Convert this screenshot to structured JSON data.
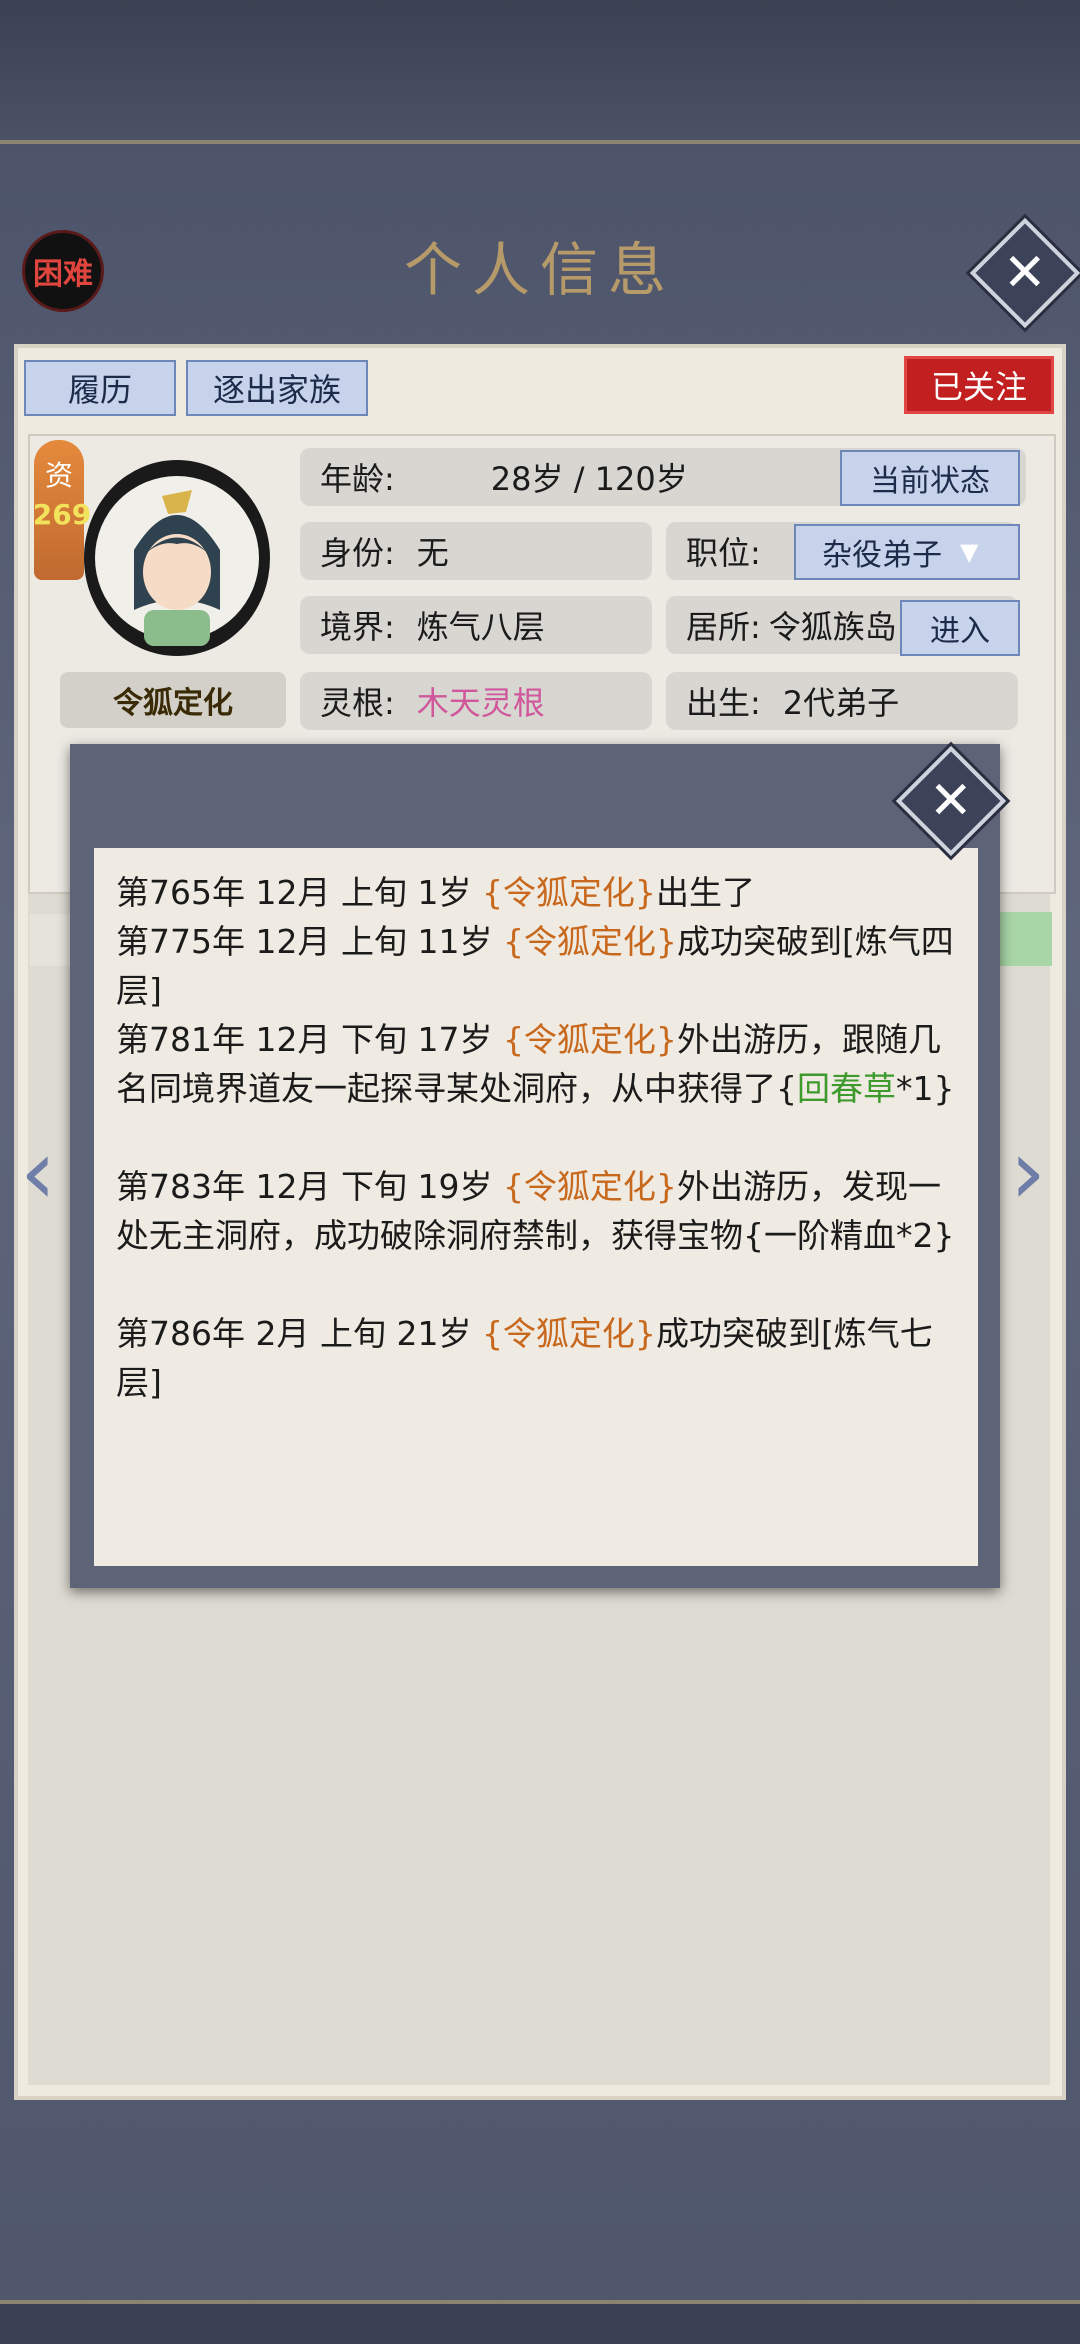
{
  "header": {
    "title": "个人信息",
    "difficulty": "困难"
  },
  "actions": {
    "history": "履历",
    "expel": "逐出家族",
    "follow": "已关注"
  },
  "profile": {
    "name": "令狐定化",
    "aptitude_label": "资",
    "aptitude_value": "269",
    "age_label": "年龄:",
    "age_value": "28岁 / 120岁",
    "status_button": "当前状态",
    "identity_label": "身份:",
    "identity_value": "无",
    "position_label": "职位:",
    "position_value": "杂役弟子",
    "realm_label": "境界:",
    "realm_value": "炼气八层",
    "residence_label": "居所:",
    "residence_value": "令狐族岛",
    "enter_button": "进入",
    "root_label": "灵根:",
    "root_value": "木天灵根",
    "birth_label": "出生:",
    "birth_value": "2代弟子"
  },
  "popup": {
    "entries": [
      {
        "pre": "第765年 12月 上旬  1岁  ",
        "name": "{令狐定化}",
        "post": "出生了"
      },
      {
        "pre": "第775年 12月 上旬  11岁  ",
        "name": "{令狐定化}",
        "post": "成功突破到[炼气四层]"
      },
      {
        "pre": "第781年 12月 下旬  17岁  ",
        "name": "{令狐定化}",
        "post": "外出游历，跟随几名同境界道友一起探寻某处洞府，从中获得了{",
        "item": "回春草",
        "tail": "*1}"
      },
      {
        "pre": "第783年 12月 下旬  19岁  ",
        "name": "{令狐定化}",
        "post": "外出游历，发现一处无主洞府，成功破除洞府禁制，获得宝物{一阶精血*2}"
      },
      {
        "pre": "第786年 2月 上旬  21岁  ",
        "name": "{令狐定化}",
        "post": "成功突破到[炼气七层]"
      }
    ]
  },
  "colors": {
    "name_highlight": "#c8681d",
    "item_highlight": "#3f9a2e",
    "root_color": "#d0579b"
  }
}
